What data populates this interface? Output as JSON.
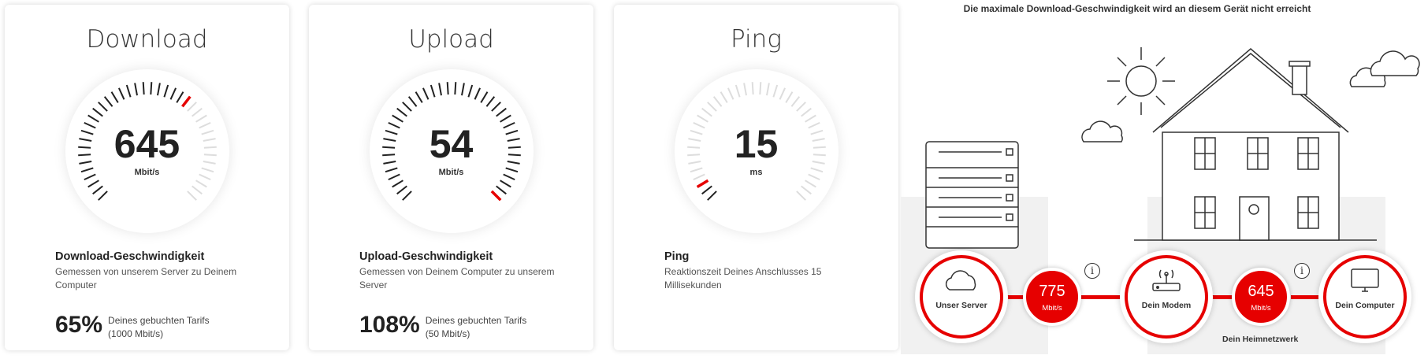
{
  "cards": [
    {
      "title": "Download",
      "value": "645",
      "unit": "Mbit/s",
      "info_title": "Download-Geschwindigkeit",
      "info_desc": "Gemessen von unserem Server zu Deinem Computer",
      "percent": "65%",
      "percent_text": "Deines gebuchten Tarifs",
      "percent_sub": "(1000 Mbit/s)",
      "gauge_fraction": 0.645
    },
    {
      "title": "Upload",
      "value": "54",
      "unit": "Mbit/s",
      "info_title": "Upload-Geschwindigkeit",
      "info_desc": "Gemessen von Deinem Computer zu unserem Server",
      "percent": "108%",
      "percent_text": "Deines gebuchten Tarifs",
      "percent_sub": "(50 Mbit/s)",
      "gauge_fraction": 1.0
    },
    {
      "title": "Ping",
      "value": "15",
      "unit": "ms",
      "info_title": "Ping",
      "info_desc": "Reaktionszeit Deines Anschlusses 15 Millisekunden",
      "gauge_fraction": 0.05
    }
  ],
  "diagram": {
    "title": "Die maximale Download-Geschwindigkeit wird an diesem Gerät nicht erreicht",
    "server_label": "Unser Server",
    "modem_label": "Dein Modem",
    "computer_label": "Dein Computer",
    "speed1_value": "775",
    "speed1_unit": "Mbit/s",
    "speed2_value": "645",
    "speed2_unit": "Mbit/s",
    "info_symbol": "i",
    "heimnetz_label": "Dein Heimnetzwerk",
    "icons": [
      "cloud-icon",
      "modem-icon",
      "computer-icon",
      "server-rack-icon",
      "house-icon",
      "sun-icon",
      "cloud-icon"
    ]
  },
  "colors": {
    "accent": "#e60000",
    "dark_tick": "#222222",
    "light_tick": "#dddddd"
  }
}
